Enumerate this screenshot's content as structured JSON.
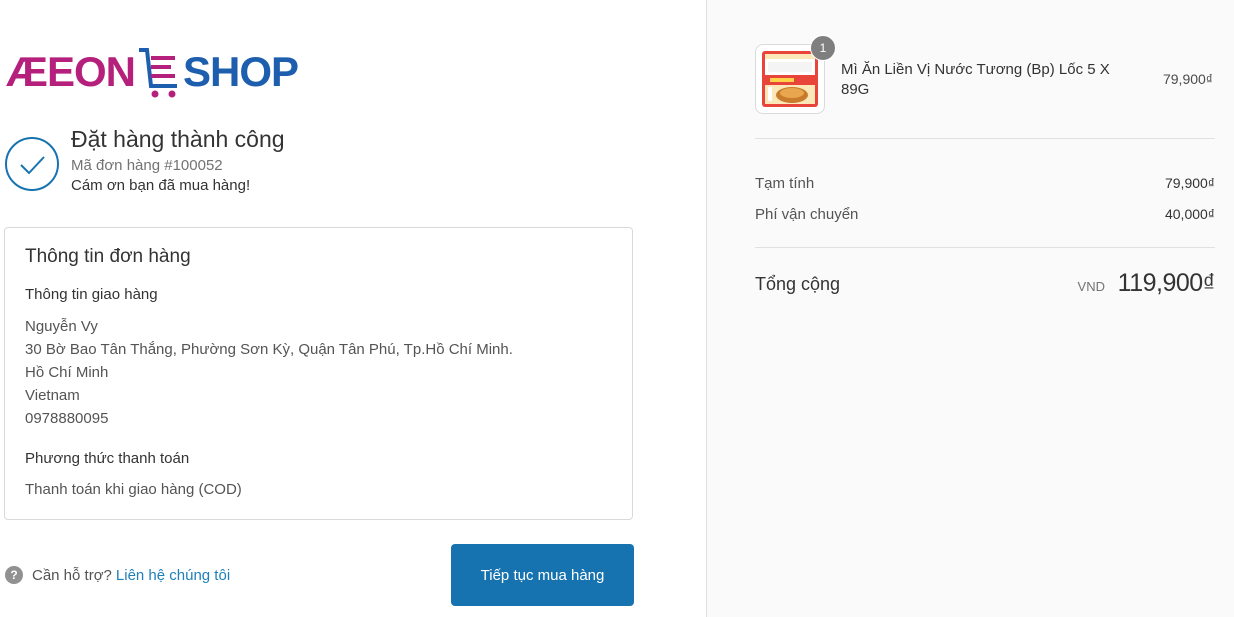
{
  "brand": {
    "logo_part1": "ÆEON",
    "logo_part2": "SHOP",
    "primary_color": "#1773b0",
    "logo_magenta": "#b5207c",
    "logo_blue": "#1d5fae"
  },
  "confirmation": {
    "title": "Đặt hàng thành công",
    "order_number": "Mã đơn hàng #100052",
    "thanks": "Cám ơn bạn đã mua hàng!",
    "icon": "check-circle-icon"
  },
  "order_info": {
    "title": "Thông tin đơn hàng",
    "shipping_heading": "Thông tin giao hàng",
    "address_lines": [
      "Nguyễn Vy",
      "30 Bờ Bao Tân Thắng, Phường Sơn Kỳ, Quận Tân Phú, Tp.Hồ Chí Minh.",
      "Hồ Chí Minh",
      "Vietnam",
      "0978880095"
    ],
    "payment_heading": "Phương thức thanh toán",
    "payment_method": "Thanh toán khi giao hàng (COD)"
  },
  "help": {
    "icon": "question-icon",
    "text": "Cần hỗ trợ?",
    "link": "Liên hệ chúng tôi"
  },
  "actions": {
    "continue_label": "Tiếp tục mua hàng"
  },
  "cart": {
    "items": [
      {
        "quantity": "1",
        "name": "Mì Ăn Liền Vị Nước Tương (Bp) Lốc 5 X 89G",
        "price": "79,900₫"
      }
    ],
    "subtotal_label": "Tạm tính",
    "subtotal_value": "79,900₫",
    "shipping_label": "Phí vận chuyển",
    "shipping_value": "40,000₫",
    "total_label": "Tổng cộng",
    "total_currency": "VND",
    "total_value": "119,900₫"
  }
}
